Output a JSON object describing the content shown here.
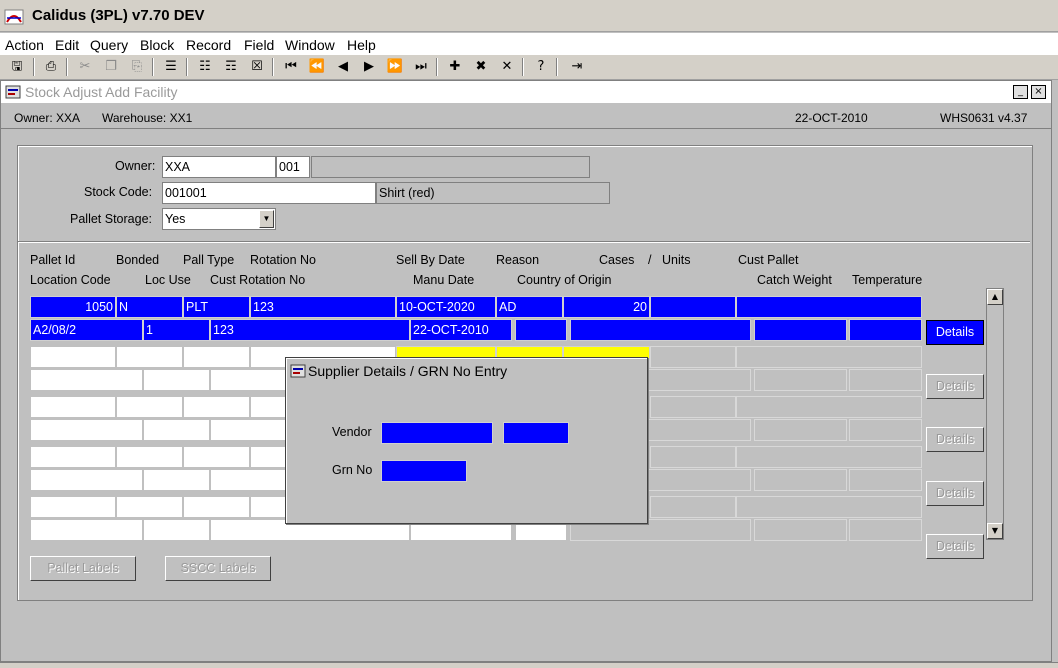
{
  "app": {
    "title": "Calidus (3PL) v7.70 DEV"
  },
  "menu": [
    "Action",
    "Edit",
    "Query",
    "Block",
    "Record",
    "Field",
    "Window",
    "Help"
  ],
  "window": {
    "title": "Stock Adjust Add Facility",
    "minimize": "_",
    "close": "×"
  },
  "info": {
    "owner": "Owner:  XXA",
    "warehouse": "Warehouse:  XX1",
    "date": "22-OCT-2010",
    "version": "WHS0631  v4.37"
  },
  "header": {
    "owner_label": "Owner:",
    "owner_code": "XXA",
    "owner_num": "001",
    "owner_name": "",
    "stock_code_label": "Stock Code:",
    "stock_code": "001001",
    "stock_desc": "Shirt (red)",
    "pallet_storage_label": "Pallet Storage:",
    "pallet_storage": "Yes"
  },
  "columns": {
    "row1": [
      "Pallet Id",
      "Bonded",
      "Pall Type",
      "Rotation No",
      "Sell By Date",
      "Reason",
      "Cases",
      "/",
      "Units",
      "Cust Pallet"
    ],
    "row2": [
      "Location Code",
      "Loc Use",
      "Cust Rotation No",
      "Manu Date",
      "Country of Origin",
      "Catch Weight",
      "Temperature"
    ]
  },
  "record1": {
    "pallet_id": "1050",
    "bonded": "N",
    "pall_type": "PLT",
    "rotation_no": "123",
    "sell_by_date": "10-OCT-2020",
    "reason": "AD",
    "cases": "20",
    "units": "",
    "cust_pallet": "",
    "location_code": "A2/08/2",
    "loc_use": "1",
    "cust_rotation_no": "123",
    "manu_date": "22-OCT-2010",
    "country_a": "",
    "country_b": "",
    "catch_weight": "",
    "temperature": ""
  },
  "buttons": {
    "details": "Details",
    "pallet_labels": "Pallet Labels",
    "sscc_labels": "SSCC Labels"
  },
  "dialog": {
    "title": "Supplier Details / GRN No Entry",
    "vendor_label": "Vendor",
    "grn_label": "Grn No",
    "vendor": "",
    "vendor_suffix": "",
    "grn": ""
  },
  "icons": {
    "save": "save-icon",
    "print": "print-icon",
    "cut": "cut-icon",
    "copy": "copy-icon",
    "paste": "paste-icon",
    "first": "first-record-icon",
    "prev_set": "previous-set-icon",
    "prev": "previous-record-icon",
    "next": "next-record-icon",
    "next_set": "next-set-icon",
    "last": "last-record-icon",
    "insert": "insert-record-icon",
    "delete": "delete-record-icon",
    "help": "help-icon",
    "exit": "exit-icon"
  },
  "colors": {
    "current_record": "#0000ff",
    "highlight": "#ffff00",
    "background": "#c0c0c0"
  }
}
